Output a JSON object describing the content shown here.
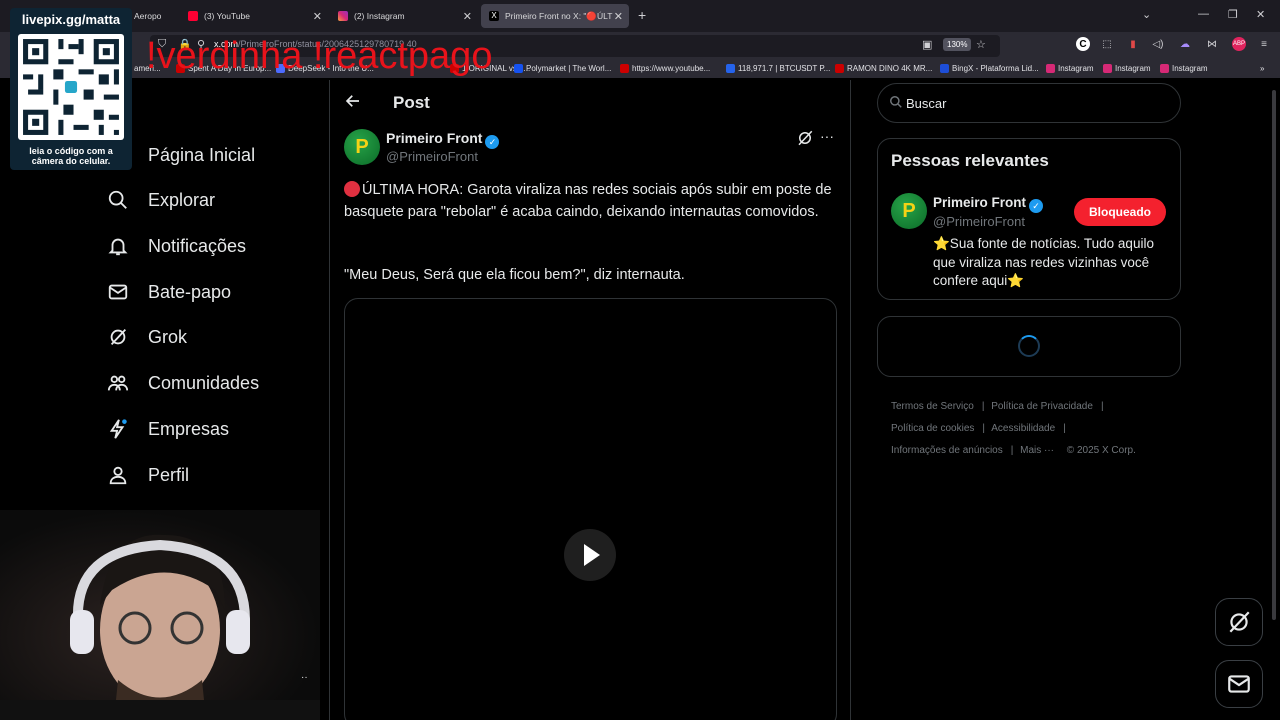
{
  "browser": {
    "tabs": [
      {
        "label": "Aeropo",
        "active": false
      },
      {
        "label": "(3) YouTube",
        "active": false
      },
      {
        "label": "(2) Instagram",
        "active": false
      },
      {
        "label": "Primeiro Front no X: \"🔴ÚLTIM",
        "active": true
      }
    ],
    "url": "x.com/PrimeiroFront/status/2006425129780719 40",
    "url_domain": "x.com",
    "url_path": "/PrimeiroFront/status/2006425129780719 40",
    "zoom": "130%",
    "bookmarks": [
      "ameri...",
      "Spent A Day In Europ...",
      "DeepSeek - Into the U...",
      "1 ORIGINAL vs 1...",
      "Polymarket | The Worl...",
      "https://www.youtube...",
      "118,971.7 | BTCUSDT P...",
      "RAMON DINO 4K MR...",
      "BingX - Plataforma Lid...",
      "Instagram",
      "Instagram",
      "Instagram"
    ]
  },
  "overlay": {
    "command_text": "!verdinha !reactpago",
    "qr_title": "livepix.gg/matta",
    "qr_caption_line1": "leia o código com a",
    "qr_caption_line2": "câmera do celular."
  },
  "nav": {
    "items": [
      {
        "label": "Página Inicial",
        "icon": "home-icon"
      },
      {
        "label": "Explorar",
        "icon": "search-icon"
      },
      {
        "label": "Notificações",
        "icon": "bell-icon"
      },
      {
        "label": "Bate-papo",
        "icon": "mail-icon"
      },
      {
        "label": "Grok",
        "icon": "grok-icon"
      },
      {
        "label": "Comunidades",
        "icon": "communities-icon"
      },
      {
        "label": "Empresas",
        "icon": "lightning-icon"
      },
      {
        "label": "Perfil",
        "icon": "person-icon"
      }
    ]
  },
  "post": {
    "header_title": "Post",
    "author_name": "Primeiro Front",
    "author_handle": "@PrimeiroFront",
    "text_line": "ÚLTIMA HORA: Garota viraliza nas redes sociais após subir em poste de basquete para \"rebolar\" é acaba caindo, deixando internautas comovidos.",
    "quote": "\"Meu Deus, Será que ela ficou bem?\", diz internauta."
  },
  "sidebar": {
    "search_placeholder": "Buscar",
    "relevant_title": "Pessoas relevantes",
    "person_name": "Primeiro Front",
    "person_handle": "@PrimeiroFront",
    "blocked_label": "Bloqueado",
    "bio": "⭐Sua fonte de notícias. Tudo aquilo que viraliza nas redes vizinhas você confere aqui⭐",
    "footer": {
      "terms": "Termos de Serviço",
      "privacy": "Política de Privacidade",
      "cookies": "Política de cookies",
      "accessibility": "Acessibilidade",
      "ads": "Informações de anúncios",
      "more": "Mais ···",
      "copyright": "© 2025 X Corp."
    }
  },
  "colors": {
    "accent": "#1d9bf0",
    "blocked": "#f4212e",
    "overlay_red": "#e8131b"
  }
}
